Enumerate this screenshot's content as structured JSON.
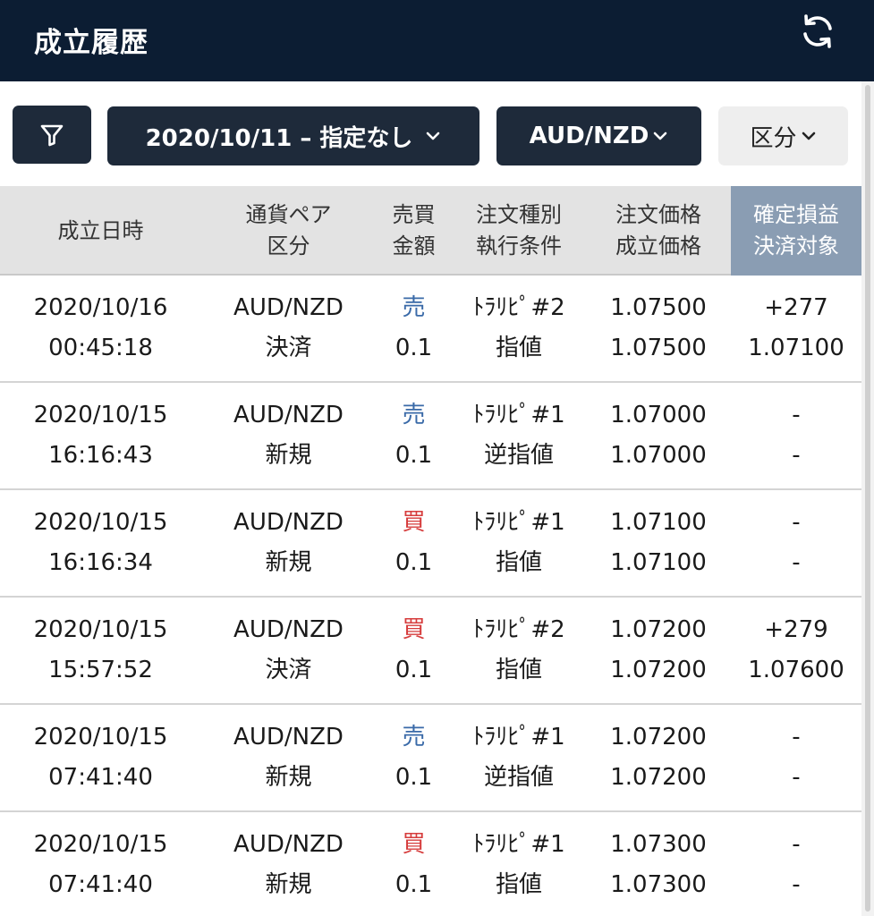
{
  "header": {
    "title": "成立履歴"
  },
  "filters": {
    "date_range": "2020/10/11 – 指定なし",
    "currency_pair": "AUD/NZD",
    "category": "区分"
  },
  "table": {
    "columns": [
      {
        "line1": "成立日時",
        "line2": ""
      },
      {
        "line1": "通貨ペア",
        "line2": "区分"
      },
      {
        "line1": "売買",
        "line2": "金額"
      },
      {
        "line1": "注文種別",
        "line2": "執行条件"
      },
      {
        "line1": "注文価格",
        "line2": "成立価格"
      },
      {
        "line1": "確定損益",
        "line2": "決済対象"
      }
    ],
    "rows": [
      {
        "date": "2020/10/16",
        "time": "00:45:18",
        "pair": "AUD/NZD",
        "kind": "決済",
        "side": "売",
        "side_type": "sell",
        "amount": "0.1",
        "order_type": "ﾄﾗﾘﾋﾟ#2",
        "condition": "指値",
        "order_price": "1.07500",
        "fill_price": "1.07500",
        "pnl": "+277",
        "target": "1.07100"
      },
      {
        "date": "2020/10/15",
        "time": "16:16:43",
        "pair": "AUD/NZD",
        "kind": "新規",
        "side": "売",
        "side_type": "sell",
        "amount": "0.1",
        "order_type": "ﾄﾗﾘﾋﾟ#1",
        "condition": "逆指値",
        "order_price": "1.07000",
        "fill_price": "1.07000",
        "pnl": "-",
        "target": "-"
      },
      {
        "date": "2020/10/15",
        "time": "16:16:34",
        "pair": "AUD/NZD",
        "kind": "新規",
        "side": "買",
        "side_type": "buy",
        "amount": "0.1",
        "order_type": "ﾄﾗﾘﾋﾟ#1",
        "condition": "指値",
        "order_price": "1.07100",
        "fill_price": "1.07100",
        "pnl": "-",
        "target": "-"
      },
      {
        "date": "2020/10/15",
        "time": "15:57:52",
        "pair": "AUD/NZD",
        "kind": "決済",
        "side": "買",
        "side_type": "buy",
        "amount": "0.1",
        "order_type": "ﾄﾗﾘﾋﾟ#2",
        "condition": "指値",
        "order_price": "1.07200",
        "fill_price": "1.07200",
        "pnl": "+279",
        "target": "1.07600"
      },
      {
        "date": "2020/10/15",
        "time": "07:41:40",
        "pair": "AUD/NZD",
        "kind": "新規",
        "side": "売",
        "side_type": "sell",
        "amount": "0.1",
        "order_type": "ﾄﾗﾘﾋﾟ#1",
        "condition": "逆指値",
        "order_price": "1.07200",
        "fill_price": "1.07200",
        "pnl": "-",
        "target": "-"
      },
      {
        "date": "2020/10/15",
        "time": "07:41:40",
        "pair": "AUD/NZD",
        "kind": "新規",
        "side": "買",
        "side_type": "buy",
        "amount": "0.1",
        "order_type": "ﾄﾗﾘﾋﾟ#1",
        "condition": "指値",
        "order_price": "1.07300",
        "fill_price": "1.07300",
        "pnl": "-",
        "target": "-"
      }
    ]
  },
  "colors": {
    "header_bg": "#0c1d33",
    "button_dark": "#1e2a3a",
    "sell": "#3a6aa8",
    "buy": "#d63c3c",
    "pnl_header": "#8a9db3"
  },
  "icons": {
    "refresh": "refresh-icon",
    "filter": "filter-funnel-icon",
    "dropdown": "chevron-down-icon"
  }
}
